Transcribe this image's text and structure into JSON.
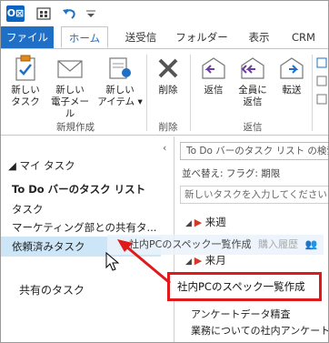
{
  "ribbon_tabs": [
    "ファイル",
    "ホーム",
    "送受信",
    "フォルダー",
    "表示",
    "CRM"
  ],
  "ribbon": {
    "new_group": {
      "label": "新規作成",
      "buttons": [
        {
          "label_line1": "新しい",
          "label_line2": "タスク"
        },
        {
          "label_line1": "新しい",
          "label_line2": "電子メール"
        },
        {
          "label_line1": "新しい",
          "label_line2": "アイテム"
        }
      ]
    },
    "delete_group": {
      "label": "削除",
      "button": "削除"
    },
    "respond_group": {
      "label": "返信",
      "buttons": [
        {
          "label_line1": "返信",
          "label_line2": ""
        },
        {
          "label_line1": "全員に",
          "label_line2": "返信"
        },
        {
          "label_line1": "転送",
          "label_line2": ""
        }
      ]
    }
  },
  "nav": {
    "section_title": "マイ タスク",
    "items": [
      "To Do バーのタスク リスト",
      "タスク",
      "マーケティング部との共有タ...",
      "依頼済みタスク"
    ],
    "shared_title": "共有のタスク"
  },
  "task_list": {
    "search_placeholder": "To Do バーのタスク リスト の検索",
    "sort_label": "並べ替え: フラグ: 期限",
    "new_task_placeholder": "新しいタスクを入力してください",
    "groups": [
      {
        "label": "来週",
        "tasks": []
      },
      {
        "label": "来月",
        "tasks": [
          "社内PCのスペック一覧作成",
          "アンケートデータ精査",
          "業務についての社内アンケート"
        ]
      }
    ]
  },
  "drag": {
    "ghost_text": "社内PCのスペック一覧作成",
    "ghost_overlay": "購入履歴",
    "highlighted_task": "社内PCのスペック一覧作成"
  },
  "colors": {
    "accent": "#1e6fc5",
    "highlight_red": "#e0191b",
    "selected_bg": "#cde6f7"
  }
}
